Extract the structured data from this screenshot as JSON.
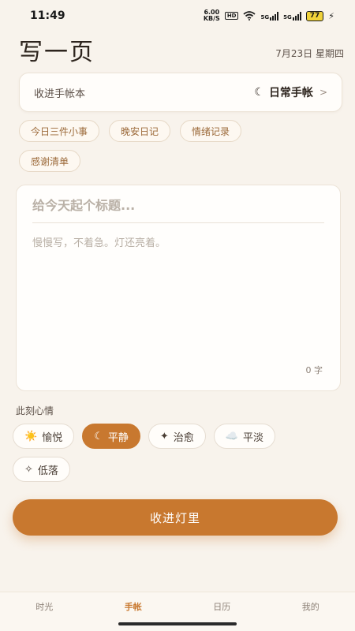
{
  "status": {
    "time": "11:49",
    "speed_value": "6.00",
    "speed_unit": "KB/S",
    "hd": "HD",
    "sig1": "5G",
    "sig2": "5G",
    "battery": "77"
  },
  "header": {
    "title": "写一页",
    "date": "7月23日 星期四"
  },
  "notebook": {
    "label": "收进手帐本",
    "icon": "moon-icon",
    "value": "日常手帐"
  },
  "tags": [
    "今日三件小事",
    "晚安日记",
    "情绪记录",
    "感谢清单"
  ],
  "editor": {
    "title_placeholder": "给今天起个标题...",
    "body_placeholder": "慢慢写，不着急。灯还亮着。",
    "char_count": "0 字"
  },
  "mood": {
    "label": "此刻心情",
    "options": [
      {
        "icon": "☀️",
        "label": "愉悦",
        "selected": false
      },
      {
        "icon": "☾",
        "label": "平静",
        "selected": true
      },
      {
        "icon": "✦",
        "label": "治愈",
        "selected": false
      },
      {
        "icon": "☁️",
        "label": "平淡",
        "selected": false
      },
      {
        "icon": "✧",
        "label": "低落",
        "selected": false
      }
    ]
  },
  "submit_label": "收进灯里",
  "tabbar": {
    "items": [
      {
        "label": "时光",
        "active": false
      },
      {
        "label": "手帐",
        "active": true
      },
      {
        "label": "日历",
        "active": false
      },
      {
        "label": "我的",
        "active": false
      }
    ]
  },
  "colors": {
    "accent": "#c8782f",
    "background": "#f8f3ec",
    "tag_text": "#9c6a3a"
  }
}
